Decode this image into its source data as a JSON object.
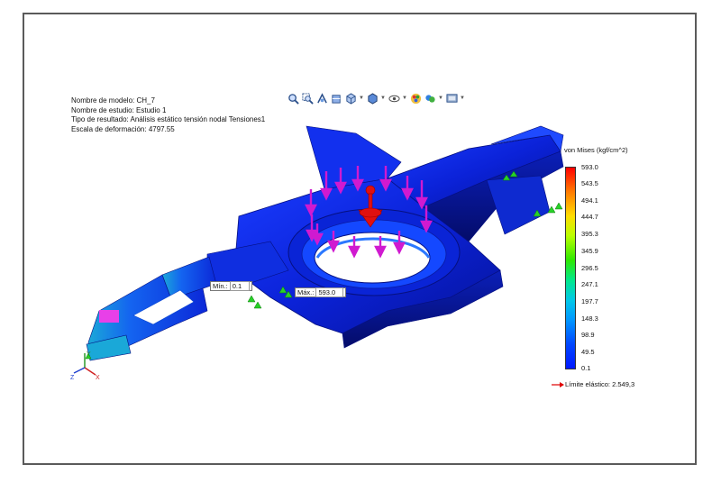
{
  "study_info": {
    "model_name": "Nombre de modelo: CH_7",
    "study_name": "Nombre de estudio: Estudio 1",
    "result_type": "Tipo de resultado: Análisis estático tensión nodal Tensiones1",
    "deformation_scale": "Escala de deformación: 4797.55"
  },
  "toolbar": {
    "items": [
      {
        "name": "zoom-to-fit-icon"
      },
      {
        "name": "zoom-to-area-icon"
      },
      {
        "name": "previous-view-icon"
      },
      {
        "name": "section-view-icon"
      },
      {
        "name": "view-orientation-icon",
        "dropdown": true
      },
      {
        "name": "display-style-icon",
        "dropdown": true
      },
      {
        "name": "hide-show-items-icon",
        "dropdown": true
      },
      {
        "name": "edit-appearance-icon"
      },
      {
        "name": "apply-scene-icon",
        "dropdown": true
      },
      {
        "name": "view-settings-icon",
        "dropdown": true
      }
    ]
  },
  "markers": {
    "min_label": "Mín.:",
    "min_value": "0.1",
    "max_label": "Máx.:",
    "max_value": "593.0"
  },
  "legend": {
    "title": "von Mises (kgf/cm^2)",
    "labels": [
      "593.0",
      "543.5",
      "494.1",
      "444.7",
      "395.3",
      "345.9",
      "296.5",
      "247.1",
      "197.7",
      "148.3",
      "98.9",
      "49.5",
      "0.1"
    ],
    "colors": {
      "max": "#ff0000",
      "mid": "#2ee800",
      "min": "#0018ff"
    }
  },
  "yield_strength": {
    "label": "Límite elástico: 2.549,3",
    "arrow_color": "#e00000"
  },
  "triad": {
    "axes": [
      "X",
      "Y",
      "Z"
    ]
  }
}
